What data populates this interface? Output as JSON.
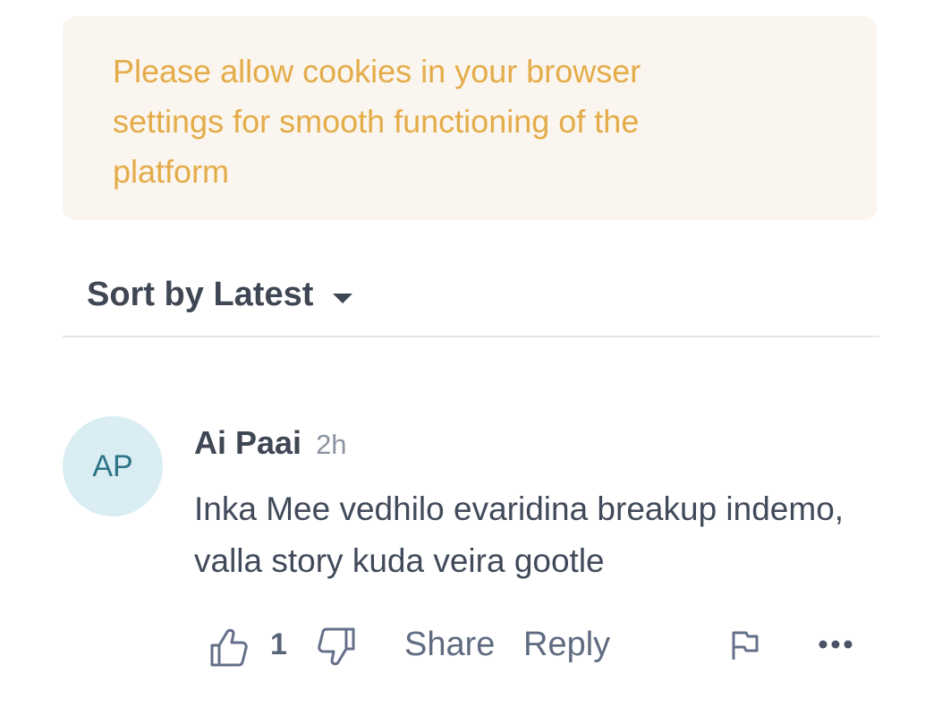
{
  "banner": {
    "message": "Please allow cookies in your browser settings for smooth functioning of the platform"
  },
  "sort": {
    "label": "Sort by Latest",
    "icon": "caret-down-icon"
  },
  "comment": {
    "avatar_initials": "AP",
    "author": "Ai Paai",
    "time": "2h",
    "body": "Inka Mee vedhilo evaridina breakup indemo, valla story kuda veira gootle",
    "likes": "1",
    "share_label": "Share",
    "reply_label": "Reply"
  },
  "colors": {
    "banner_bg": "#faf5ee",
    "banner_text": "#e4ac49",
    "avatar_bg": "#d9edf3",
    "avatar_text": "#2e7488",
    "primary_text": "#3f4654",
    "action_text": "#5f6b80"
  }
}
